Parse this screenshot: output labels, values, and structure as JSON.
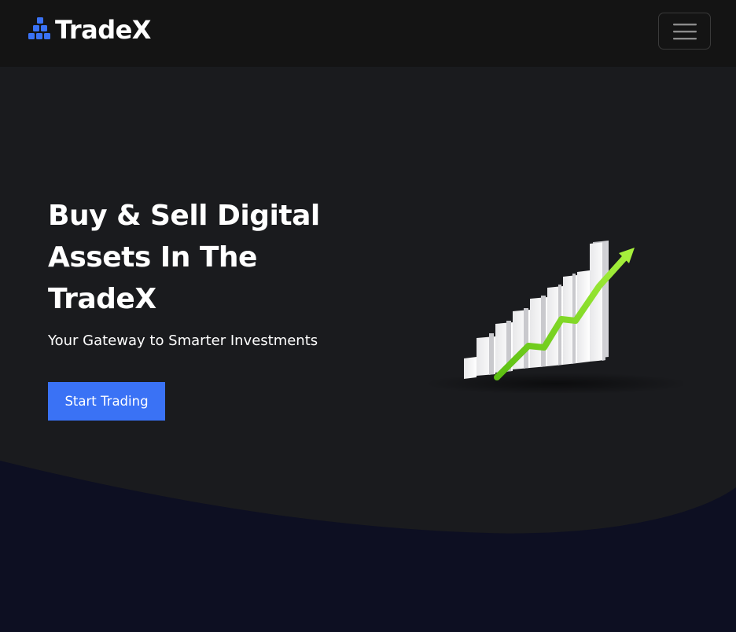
{
  "navbar": {
    "brand_name": "TradeX",
    "logo_icon": "blocks-logo-icon",
    "menu_icon": "hamburger-menu-icon"
  },
  "hero": {
    "title": "Buy & Sell Digital Assets In The TradeX",
    "subtitle": "Your Gateway to Smarter Investments",
    "cta_label": "Start Trading",
    "illustration_icon": "growth-bar-chart-arrow-icon"
  },
  "colors": {
    "navbar_bg": "#141414",
    "hero_bg": "#1a1b1e",
    "lower_bg": "#0d0f22",
    "accent": "#3a72f5",
    "arrow_green": "#7ed321"
  }
}
